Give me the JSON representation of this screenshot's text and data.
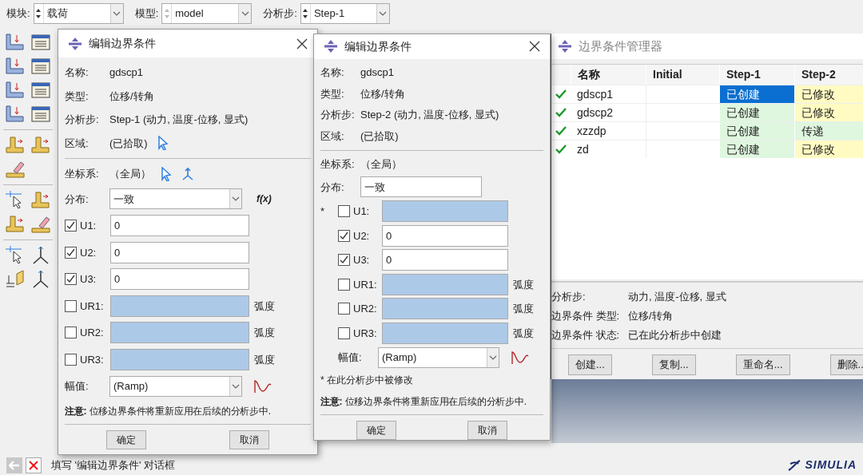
{
  "toolbar": {
    "selectors": [
      {
        "label": "模块:",
        "value": "载荷",
        "spin_enabled": true
      },
      {
        "label": "模型:",
        "value": "model",
        "spin_enabled": false
      },
      {
        "label": "分析步:",
        "value": "Step-1",
        "spin_enabled": true
      }
    ]
  },
  "dialogs": [
    {
      "title": "编辑边界条件",
      "fields": [
        {
          "label": "名称:",
          "value": "gdscp1",
          "pick": false
        },
        {
          "label": "类型:",
          "value": "位移/转角",
          "pick": false
        },
        {
          "label": "分析步:",
          "value": "Step-1 (动力, 温度-位移, 显式)",
          "pick": false
        },
        {
          "label": "区域:",
          "value": "(已拾取)",
          "pick": true
        }
      ],
      "csys": {
        "label": "坐标系:",
        "value": "（全局）",
        "pick": true
      },
      "distribution": {
        "label": "分布:",
        "value": "一致",
        "kind": "dropdown",
        "fx": "f(x)"
      },
      "dofs": [
        {
          "label": "U1:",
          "checked": true,
          "value": "0"
        },
        {
          "label": "U2:",
          "checked": true,
          "value": "0"
        },
        {
          "label": "U3:",
          "checked": true,
          "value": "0"
        },
        {
          "label": "UR1:",
          "checked": false,
          "unit": "弧度"
        },
        {
          "label": "UR2:",
          "checked": false,
          "unit": "弧度"
        },
        {
          "label": "UR3:",
          "checked": false,
          "unit": "弧度"
        }
      ],
      "amplitude": {
        "label": "幅值:",
        "value": "(Ramp)"
      },
      "note": "**注意:** 位移边界条件将重新应用在后续的分析步中.",
      "buttons": [
        "确定",
        "取消"
      ]
    },
    {
      "title": "编辑边界条件",
      "fields": [
        {
          "label": "名称:",
          "value": "gdscp1",
          "pick": false
        },
        {
          "label": "类型:",
          "value": "位移/转角",
          "pick": false
        },
        {
          "label": "分析步:",
          "value": "Step-2 (动力, 温度-位移, 显式)",
          "pick": false
        },
        {
          "label": "区域:",
          "value": "(已拾取)",
          "pick": false
        }
      ],
      "csys": {
        "label": "坐标系:",
        "value": "（全局）",
        "pick": false
      },
      "distribution": {
        "label": "分布:",
        "value": "一致",
        "kind": "text"
      },
      "dofs": [
        {
          "label": "U1:",
          "checked": false,
          "marker": "*"
        },
        {
          "label": "U2:",
          "checked": true,
          "value": "0"
        },
        {
          "label": "U3:",
          "checked": true,
          "value": "0"
        },
        {
          "label": "UR1:",
          "checked": false,
          "unit": "弧度"
        },
        {
          "label": "UR2:",
          "checked": false,
          "unit": "弧度"
        },
        {
          "label": "UR3:",
          "checked": false,
          "unit": "弧度"
        }
      ],
      "amplitude": {
        "label": "幅值:",
        "value": "(Ramp)"
      },
      "footnote": "* 在此分析步中被修改",
      "note": "**注意:** 位移边界条件将重新应用在后续的分析步中.",
      "buttons": [
        "确定",
        "取消"
      ]
    }
  ],
  "manager": {
    "title": "边界条件管理器",
    "columns": [
      "名称",
      "Initial",
      "Step-1",
      "Step-2"
    ],
    "rows": [
      {
        "active": true,
        "name": "gdscp1",
        "step_1": {
          "text": "已创建",
          "selected": true
        },
        "step_2": {
          "text": "已修改",
          "color": "#fffbc2",
          "selected": false
        }
      },
      {
        "active": true,
        "name": "gdscp2",
        "step_1": {
          "text": "已创建",
          "color": "#dff6df",
          "selected": false
        },
        "step_2": {
          "text": "已修改",
          "color": "#fffbc2",
          "selected": false
        }
      },
      {
        "active": true,
        "name": "xzzdp",
        "step_1": {
          "text": "已创建",
          "color": "#dff6df",
          "selected": false
        },
        "step_2": {
          "text": "传递",
          "color": "#dff6df",
          "selected": false
        }
      },
      {
        "active": true,
        "name": "zd",
        "step_1": {
          "text": "已创建",
          "color": "#dff6df",
          "selected": false
        },
        "step_2": {
          "text": "已修改",
          "color": "#fffbc2",
          "selected": false
        }
      }
    ],
    "summary": [
      {
        "label": "分析步:",
        "value": "动力, 温度-位移, 显式"
      },
      {
        "label": "边界条件 类型:",
        "value": "位移/转角"
      },
      {
        "label": "边界条件 状态:",
        "value": "已在此分析步中创建"
      }
    ],
    "buttons": [
      "创建...",
      "复制...",
      "重命名...",
      "删除.."
    ]
  },
  "prompt": {
    "text": "填写 '编辑边界条件' 对话框"
  },
  "logo": "SIMULIA"
}
